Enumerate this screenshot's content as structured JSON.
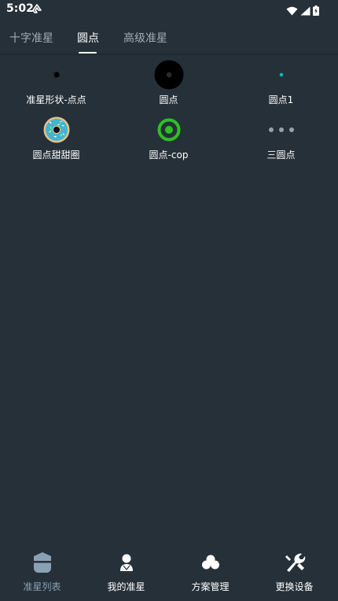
{
  "status_bar": {
    "time": "5:02",
    "icons": [
      "app-notification-icon",
      "wifi-icon",
      "cell-signal-icon",
      "battery-charging-icon"
    ]
  },
  "tabs": [
    {
      "label": "十字准星",
      "active": false
    },
    {
      "label": "圆点",
      "active": true
    },
    {
      "label": "高级准星",
      "active": false
    }
  ],
  "crosshairs": [
    {
      "label": "准星形状-点点",
      "icon": "small-black-dot"
    },
    {
      "label": "圆点",
      "icon": "large-black-circle-dot"
    },
    {
      "label": "圆点1",
      "icon": "tiny-cyan-dot"
    },
    {
      "label": "圆点甜甜圈",
      "icon": "donut-sprinkles"
    },
    {
      "label": "圆点-cop",
      "icon": "green-ring-dot"
    },
    {
      "label": "三圆点",
      "icon": "three-grey-dots"
    }
  ],
  "bottom_nav": [
    {
      "label": "准星列表",
      "icon": "crosshair-list-icon",
      "active": true
    },
    {
      "label": "我的准星",
      "icon": "user-icon",
      "active": false
    },
    {
      "label": "方案管理",
      "icon": "clover-icon",
      "active": false
    },
    {
      "label": "更换设备",
      "icon": "wrench-icon",
      "active": false
    }
  ],
  "colors": {
    "background": "#253039",
    "active_nav": "#8aa1b3",
    "inactive_tab": "#a4acb2",
    "green_ring": "#2ec022",
    "cyan_dot": "#12b6b8"
  }
}
